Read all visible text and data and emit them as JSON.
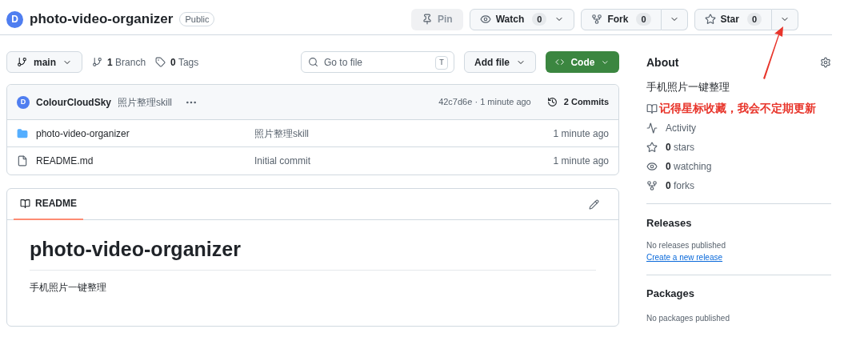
{
  "repo": {
    "avatar_letter": "D",
    "name": "photo-video-organizer",
    "visibility": "Public"
  },
  "actions": [
    {
      "kind": "pin",
      "label": "Pin",
      "disabled": true
    },
    {
      "kind": "watch",
      "label": "Watch",
      "count": "0",
      "split": false
    },
    {
      "kind": "fork",
      "label": "Fork",
      "count": "0",
      "split": true
    },
    {
      "kind": "star",
      "label": "Star",
      "count": "0",
      "split": true
    }
  ],
  "toolbar": {
    "branch": "main",
    "branches_count": "1",
    "branches_label": "Branch",
    "tags_count": "0",
    "tags_label": "Tags",
    "search_placeholder": "Go to file",
    "search_key": "T",
    "add_file": "Add file",
    "code": "Code"
  },
  "commit": {
    "avatar_letter": "D",
    "author": "ColourCloudSky",
    "message": "照片整理skill",
    "hash": "42c7d6e",
    "separator": "·",
    "time": "1 minute ago",
    "commits_count": "2",
    "commits_label": "Commits"
  },
  "files": [
    {
      "kind": "folder",
      "name": "photo-video-organizer",
      "message": "照片整理skill",
      "time": "1 minute ago"
    },
    {
      "kind": "file",
      "name": "README.md",
      "message": "Initial commit",
      "time": "1 minute ago"
    }
  ],
  "readme": {
    "tab": "README",
    "selected": true,
    "title": "photo-video-organizer",
    "body": "手机照片一键整理"
  },
  "about": {
    "title": "About",
    "description": "手机照片一键整理",
    "items": [
      {
        "kind": "annotation",
        "label": "记得星标收藏，我会不定期更新"
      },
      {
        "kind": "activity",
        "label": "Activity"
      },
      {
        "kind": "stars",
        "count": "0",
        "label": "stars"
      },
      {
        "kind": "watching",
        "count": "0",
        "label": "watching"
      },
      {
        "kind": "forks",
        "count": "0",
        "label": "forks"
      }
    ]
  },
  "releases": {
    "title": "Releases",
    "empty": "No releases published",
    "link": "Create a new release"
  },
  "packages": {
    "title": "Packages",
    "empty": "No packages published"
  }
}
